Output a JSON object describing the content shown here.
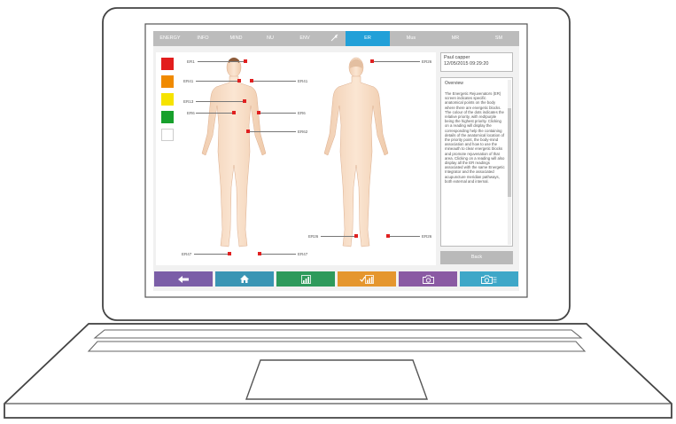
{
  "colors": {
    "active_tab": "#22a0d8",
    "marker": "#e02020",
    "back_button": "#b9b9b9",
    "bottom_buttons": [
      "#7b5ea7",
      "#3a95b4",
      "#2e9a5b",
      "#e5962e",
      "#8a5aa3",
      "#3ea7c8"
    ]
  },
  "nav": {
    "tabs": [
      {
        "label": "ENERGY"
      },
      {
        "label": "INFO"
      },
      {
        "label": "MIND"
      },
      {
        "label": "NU"
      },
      {
        "label": "ENV"
      },
      {
        "label": ""
      },
      {
        "label": "ER"
      },
      {
        "label": "Mus"
      },
      {
        "label": "MR"
      },
      {
        "label": "SM"
      }
    ]
  },
  "legend": {
    "swatches": [
      "#e21d1d",
      "#f08a00",
      "#f6e300",
      "#17a02c",
      "#ffffff"
    ]
  },
  "body_points": {
    "front": {
      "er1": "ER1",
      "er41_left": "ER41",
      "er41_right": "ER41",
      "er13": "ER13",
      "er6_left": "ER6",
      "er6_right": "ER6",
      "er62": "ER62",
      "er47_left": "ER47",
      "er47_right": "ER47"
    },
    "back": {
      "er26_top": "ER26",
      "er26_left": "ER26",
      "er26_right": "ER26"
    }
  },
  "patient": {
    "name": "Paul capper",
    "datetime": "12/05/2015 09:29:20"
  },
  "overview": {
    "title": "Overview",
    "text": "The Energetic Rejuvenators (ER) screen indicates specific anatomical points on the body where there are energetic blocks. The colour of the dots indicates the relative priority, with red/purple being the highest priority. Clicking on a reading will display the corresponding help the containing details of the anatomical location of the priority point, the body-mind association and how to use the mineauth to clear energetic blocks and promote rejuvenation of that area. Clicking on a reading will also display all the ER readings associated with the same Energetic Integrator and the associated acupuncture meridian pathways, both external and internal."
  },
  "back_label": "Back",
  "bottom_bar": {
    "icons": [
      "back-arrow-icon",
      "home-icon",
      "chart-icon",
      "check-chart-icon",
      "camera-icon",
      "camera-settings-icon"
    ]
  }
}
